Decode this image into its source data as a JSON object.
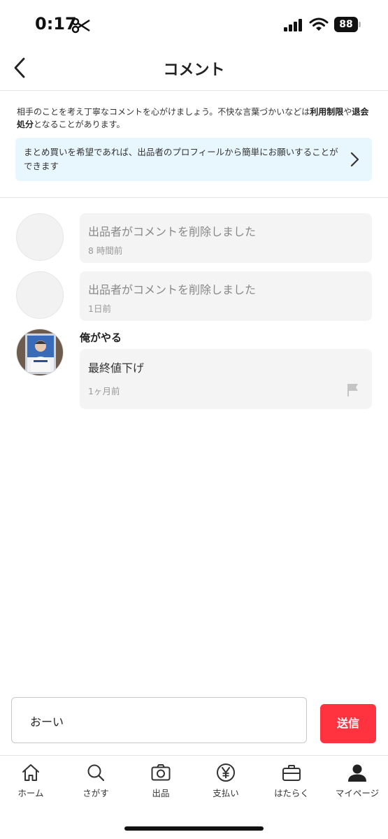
{
  "status_bar": {
    "time": "0:17",
    "battery": "88"
  },
  "header": {
    "title": "コメント"
  },
  "notice": {
    "part1": "相手のことを考え丁寧なコメントを心がけましょう。不快な言葉づかいなどは",
    "bold1": "利用制限",
    "part2": "や",
    "bold2": "退会処分",
    "part3": "となることがあります。"
  },
  "info_banner": {
    "text": "まとめ買いを希望であれば、出品者のプロフィールから簡単にお願いすることができます"
  },
  "comments": [
    {
      "text": "出品者がコメントを削除しました",
      "time": "8 時間前"
    },
    {
      "text": "出品者がコメントを削除しました",
      "time": "1日前"
    },
    {
      "author": "俺がやる",
      "text": "最終値下げ",
      "time": "1ヶ月前"
    }
  ],
  "composer": {
    "value": "おーい",
    "send_label": "送信"
  },
  "tabs": [
    {
      "label": "ホーム",
      "icon": "home-icon"
    },
    {
      "label": "さがす",
      "icon": "search-icon"
    },
    {
      "label": "出品",
      "icon": "camera-icon"
    },
    {
      "label": "支払い",
      "icon": "yen-icon"
    },
    {
      "label": "はたらく",
      "icon": "briefcase-icon"
    },
    {
      "label": "マイページ",
      "icon": "person-icon"
    }
  ]
}
